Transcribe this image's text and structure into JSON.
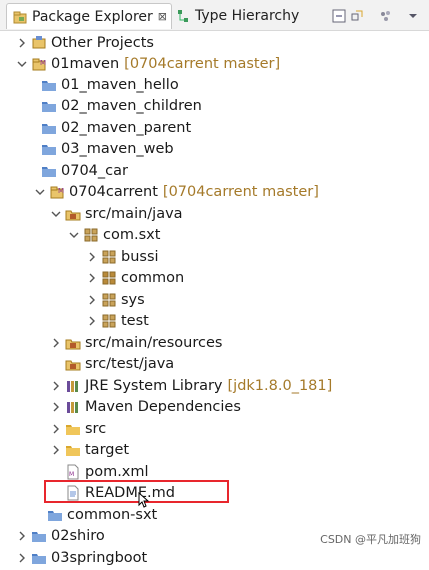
{
  "tabs": [
    {
      "label": "Package Explorer",
      "close": "⊠"
    },
    {
      "label": "Type Hierarchy"
    }
  ],
  "toolbar_icons": [
    "collapse-all-icon",
    "link-with-editor-icon",
    "filters-icon",
    "view-menu-icon"
  ],
  "tree": [
    {
      "label": "Other Projects"
    },
    {
      "label": "01maven",
      "decoration": "[0704carrent master]"
    },
    {
      "label": "01_maven_hello"
    },
    {
      "label": "02_maven_children"
    },
    {
      "label": "02_maven_parent"
    },
    {
      "label": "03_maven_web"
    },
    {
      "label": "0704_car"
    },
    {
      "label": "0704carrent",
      "decoration": "[0704carrent master]"
    },
    {
      "label": "src/main/java"
    },
    {
      "label": "com.sxt"
    },
    {
      "label": "bussi"
    },
    {
      "label": "common"
    },
    {
      "label": "sys"
    },
    {
      "label": "test"
    },
    {
      "label": "src/main/resources"
    },
    {
      "label": "src/test/java"
    },
    {
      "label": "JRE System Library",
      "decoration": "[jdk1.8.0_181]"
    },
    {
      "label": "Maven Dependencies"
    },
    {
      "label": "src"
    },
    {
      "label": "target"
    },
    {
      "label": "pom.xml"
    },
    {
      "label": "README.md"
    },
    {
      "label": "common-sxt"
    },
    {
      "label": "02shiro"
    },
    {
      "label": "03springboot"
    }
  ],
  "colors": {
    "highlight_box": "#e8262d",
    "decoration": "#a57a2a",
    "folder": "#4f7fc6"
  },
  "watermark": "CSDN @平凡加班狗"
}
